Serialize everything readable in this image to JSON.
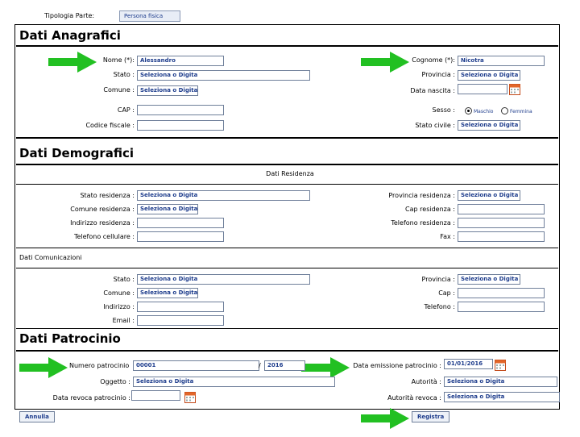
{
  "header": {
    "tipologia_label": "Tipologia Parte:",
    "tipologia_value": "Persona fisica"
  },
  "anagrafici": {
    "title": "Dati Anagrafici",
    "nome_label": "Nome (*):",
    "nome_value": "Alessandro",
    "cognome_label": "Cognome (*):",
    "cognome_value": "Nicotra",
    "stato_label": "Stato :",
    "stato_value": "Seleziona o Digita",
    "provincia_label": "Provincia :",
    "provincia_value": "Seleziona o Digita",
    "comune_label": "Comune :",
    "comune_value": "Seleziona o Digita",
    "data_nascita_label": "Data nascita :",
    "data_nascita_value": "",
    "cap_label": "CAP :",
    "cap_value": "",
    "sesso_label": "Sesso :",
    "sesso_options": [
      "Maschio",
      "Femmina"
    ],
    "sesso_selected": "Maschio",
    "codice_fiscale_label": "Codice fiscale :",
    "codice_fiscale_value": "",
    "stato_civile_label": "Stato civile :",
    "stato_civile_value": "Seleziona o Digita"
  },
  "demografici": {
    "title": "Dati Demografici",
    "residenza_heading": "Dati Residenza",
    "stato_res_label": "Stato residenza :",
    "stato_res_value": "Seleziona o Digita",
    "provincia_res_label": "Provincia residenza :",
    "provincia_res_value": "Seleziona o Digita",
    "comune_res_label": "Comune residenza :",
    "comune_res_value": "Seleziona o Digita",
    "cap_res_label": "Cap residenza :",
    "cap_res_value": "",
    "indirizzo_res_label": "Indirizzo residenza :",
    "indirizzo_res_value": "",
    "telefono_res_label": "Telefono residenza :",
    "telefono_res_value": "",
    "cellulare_label": "Telefono cellulare :",
    "cellulare_value": "",
    "fax_label": "Fax :",
    "fax_value": "",
    "comunicazioni_heading": "Dati Comunicazioni",
    "stato_label": "Stato :",
    "stato_value": "Seleziona o Digita",
    "provincia_label": "Provincia :",
    "provincia_value": "Seleziona o Digita",
    "comune_label": "Comune :",
    "comune_value": "Seleziona o Digita",
    "cap_label": "Cap :",
    "cap_value": "",
    "indirizzo_label": "Indirizzo :",
    "indirizzo_value": "",
    "telefono_label": "Telefono :",
    "telefono_value": "",
    "email_label": "Email :",
    "email_value": ""
  },
  "patrocinio": {
    "title": "Dati Patrocinio",
    "numero_label": "Numero patrocinio",
    "numero_value": "00001",
    "separator": "/",
    "anno_value": "2016",
    "data_emissione_label": "Data emissione patrocinio :",
    "data_emissione_value": "01/01/2016",
    "oggetto_label": "Oggetto :",
    "oggetto_value": "Seleziona o Digita",
    "autorita_label": "Autorità :",
    "autorita_value": "Seleziona o Digita",
    "data_revoca_label": "Data revoca patrocinio :",
    "data_revoca_value": "",
    "autorita_revoca_label": "Autorità revoca :",
    "autorita_revoca_value": "Seleziona o Digita"
  },
  "footer": {
    "annulla_label": "Annulla",
    "registra_label": "Registra"
  },
  "colors": {
    "arrow": "#22c022",
    "field_text": "#1d3c8c",
    "field_border": "#6f7f9a"
  },
  "icons": {
    "arrow": "green-arrow-icon",
    "calendar": "calendar-icon"
  }
}
